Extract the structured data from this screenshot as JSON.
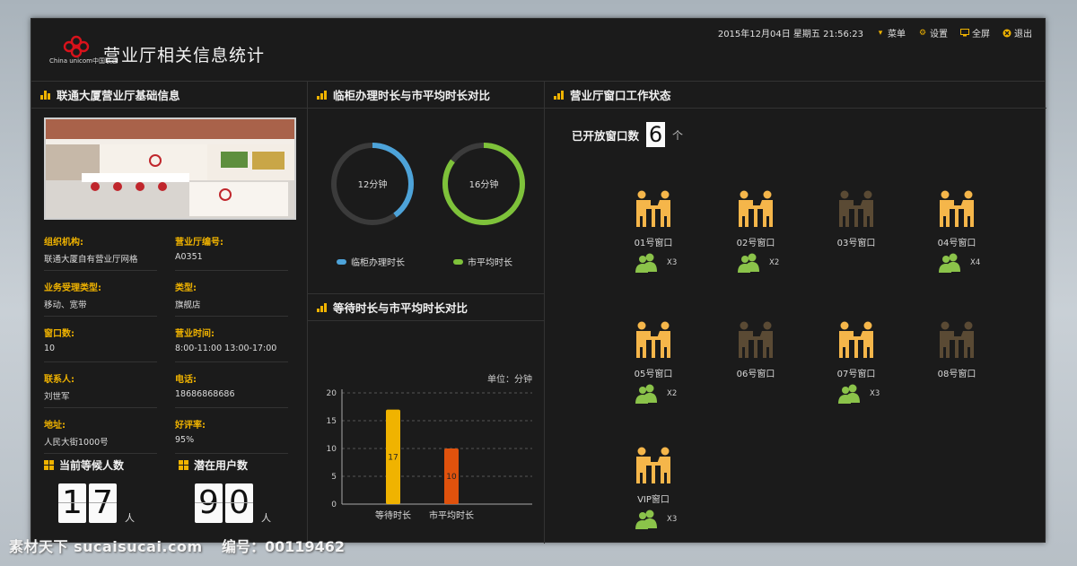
{
  "header": {
    "title": "营业厅相关信息统计",
    "logo_text": "China unicom中国联通",
    "datetime": "2015年12月04日 星期五 21:56:23",
    "menu_label": "菜单",
    "settings_label": "设置",
    "fullscreen_label": "全屏",
    "exit_label": "退出"
  },
  "basic_info": {
    "title": "联通大厦营业厅基础信息",
    "fields": [
      {
        "label": "组织机构:",
        "value": "联通大厦自有营业厅网格"
      },
      {
        "label": "营业厅编号:",
        "value": "A0351"
      },
      {
        "label": "业务受理类型:",
        "value": "移动、宽带"
      },
      {
        "label": "类型:",
        "value": "旗舰店"
      },
      {
        "label": "窗口数:",
        "value": "10"
      },
      {
        "label": "营业时间:",
        "value": "8:00-11:00 13:00-17:00"
      },
      {
        "label": "联系人:",
        "value": "刘世军"
      },
      {
        "label": "电话:",
        "value": "18686868686"
      },
      {
        "label": "地址:",
        "value": "人民大街1000号"
      },
      {
        "label": "好评率:",
        "value": "95%"
      }
    ],
    "waiting": {
      "title": "当前等候人数",
      "digits": [
        "1",
        "7"
      ],
      "unit": "人"
    },
    "potential": {
      "title": "潜在用户数",
      "digits": [
        "9",
        "0"
      ],
      "unit": "人"
    }
  },
  "compare_time": {
    "title": "临柜办理时长与市平均时长对比",
    "rings": [
      {
        "label": "12分钟",
        "fraction": 0.4,
        "color": "#4da3d9"
      },
      {
        "label": "16分钟",
        "fraction": 0.85,
        "color": "#7ec23a"
      }
    ],
    "legend": [
      {
        "name": "临柜办理时长",
        "color": "#4da3d9"
      },
      {
        "name": "市平均时长",
        "color": "#7ec23a"
      }
    ]
  },
  "chart_data": {
    "type": "bar",
    "title": "等待时长与市平均时长对比",
    "unit_label": "单位：分钟",
    "categories": [
      "等待时长",
      "市平均时长"
    ],
    "values": [
      17,
      10
    ],
    "data_labels": [
      "17",
      "10"
    ],
    "colors": [
      "#f0b300",
      "#e0520d"
    ],
    "ylim": [
      0,
      20
    ],
    "yticks": [
      "0",
      "5",
      "10",
      "15",
      "20"
    ],
    "grid": true
  },
  "window_status": {
    "title": "营业厅窗口工作状态",
    "open_label": "已开放窗口数",
    "open_count": "6",
    "open_unit": "个",
    "windows": [
      {
        "label": "01号窗口",
        "active": true,
        "queue": "X3"
      },
      {
        "label": "02号窗口",
        "active": true,
        "queue": "X2"
      },
      {
        "label": "03号窗口",
        "active": false,
        "queue": ""
      },
      {
        "label": "04号窗口",
        "active": true,
        "queue": "X4"
      },
      {
        "label": "05号窗口",
        "active": true,
        "queue": "X2"
      },
      {
        "label": "06号窗口",
        "active": false,
        "queue": ""
      },
      {
        "label": "07号窗口",
        "active": true,
        "queue": "X3"
      },
      {
        "label": "08号窗口",
        "active": false,
        "queue": ""
      },
      {
        "label": "VIP窗口",
        "active": true,
        "queue": "X3"
      }
    ],
    "colors": {
      "active": "#f5b64a",
      "inactive": "#5a4a34",
      "person": "#8bc34a"
    }
  },
  "watermark": {
    "left": "素材天下 sucaisucai.com",
    "right": "编号：00119462"
  }
}
